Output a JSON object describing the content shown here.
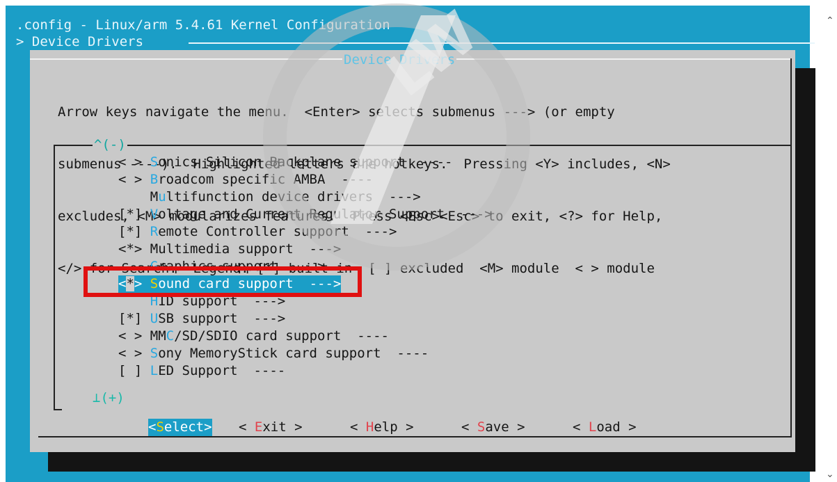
{
  "window": {
    "title": ".config - Linux/arm 5.4.61 Kernel Configuration",
    "breadcrumb": "> Device Drivers "
  },
  "dialog": {
    "title": "Device Drivers",
    "help_lines": [
      "Arrow keys navigate the menu.  <Enter> selects submenus ---> (or empty",
      "submenus ----).  Highlighted letters are hotkeys.  Pressing <Y> includes, <N>",
      "excludes, <M> modularizes features.  Press <Esc><Esc> to exit, <?> for Help,",
      "</> for Search.  Legend: [*] built-in  [ ] excluded  <M> module  < > module"
    ],
    "scroll_up": "^(-)",
    "scroll_down": "⊥(+)"
  },
  "menu": {
    "items": [
      {
        "prefix": "< > ",
        "hotkey": "S",
        "rest": "onics Silicon Backplane support  ----"
      },
      {
        "prefix": "< > ",
        "hotkey": "B",
        "rest": "roadcom specific AMBA  ----"
      },
      {
        "prefix": "    ",
        "pre": "M",
        "hotkey": "u",
        "rest": "ltifunction device drivers  --->"
      },
      {
        "prefix": "[*] ",
        "hotkey": "V",
        "rest": "oltage and Current Regulator Support  --->"
      },
      {
        "prefix": "[*] ",
        "hotkey": "R",
        "rest": "emote Controller support  --->"
      },
      {
        "prefix": "<*> ",
        "pre": "Mu",
        "hotkey": "",
        "rest": "ltimedia support  --->"
      },
      {
        "prefix": "    ",
        "hotkey": "G",
        "rest": "raphics support  --->"
      },
      {
        "prefix": "<*> ",
        "hotkey": "S",
        "rest": "ound card support  --->",
        "selected": true
      },
      {
        "prefix": "    ",
        "hotkey": "H",
        "rest": "ID support  --->"
      },
      {
        "prefix": "[*] ",
        "hotkey": "U",
        "rest": "SB support  --->"
      },
      {
        "prefix": "< > ",
        "pre": "MM",
        "hotkey": "C",
        "rest": "/SD/SDIO card support  ----"
      },
      {
        "prefix": "< > ",
        "hotkey": "S",
        "rest": "ony MemoryStick card support  ----"
      },
      {
        "prefix": "[ ] ",
        "hotkey": "L",
        "rest": "ED Support  ----"
      }
    ]
  },
  "buttons": [
    {
      "open": "<",
      "hotkey": "S",
      "rest": "elect",
      "close": ">",
      "active": true
    },
    {
      "open": "< ",
      "hotkey": "E",
      "rest": "xit",
      "close": " >"
    },
    {
      "open": "< ",
      "hotkey": "H",
      "rest": "elp",
      "close": " >"
    },
    {
      "open": "< ",
      "hotkey": "S",
      "rest": "ave",
      "close": " >"
    },
    {
      "open": "< ",
      "hotkey": "L",
      "rest": "oad",
      "close": " >"
    }
  ],
  "colors": {
    "terminal_bg": "#1b9ec7",
    "dialog_bg": "#c9c9c9",
    "hotkey": "#28a8e0",
    "selected_hotkey": "#f2d100",
    "button_hotkey": "#e2424c",
    "annotation_red": "#e01010"
  },
  "icons": {
    "scroll_up": "chevron-up-icon",
    "scroll_down": "chevron-down-icon",
    "watermark": "watermark-logo"
  }
}
